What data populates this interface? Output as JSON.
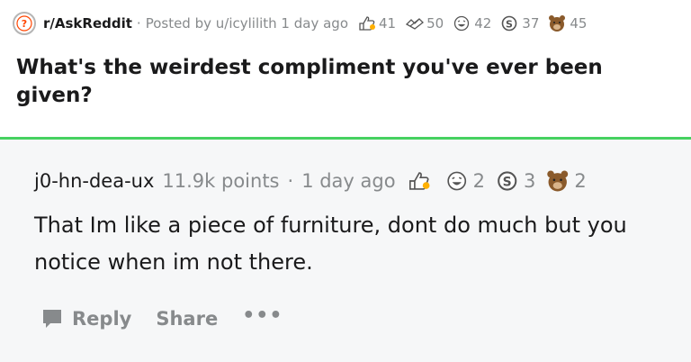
{
  "post": {
    "subreddit": "r/AskReddit",
    "separator": "·",
    "posted_by": "Posted by u/icylilith 1 day ago",
    "awards": [
      {
        "icon": "helpful-award-icon",
        "count": "41"
      },
      {
        "icon": "wholesome-award-icon",
        "count": "50"
      },
      {
        "icon": "laughing-award-icon",
        "count": "42"
      },
      {
        "icon": "silver-award-icon",
        "count": "37"
      },
      {
        "icon": "bear-award-icon",
        "count": "45"
      }
    ],
    "title": "What's the weirdest compliment you've ever been given?"
  },
  "comment": {
    "author": "j0-hn-dea-ux",
    "points": "11.9k points",
    "separator": "·",
    "time": "1 day ago",
    "awards": [
      {
        "icon": "helpful-award-icon",
        "count": ""
      },
      {
        "icon": "laughing-award-icon",
        "count": "2"
      },
      {
        "icon": "silver-award-icon",
        "count": "3"
      },
      {
        "icon": "bear-award-icon",
        "count": "2"
      }
    ],
    "body": "That Im like a piece of furniture, dont do much but you notice when im not there.",
    "actions": {
      "reply_label": "Reply",
      "share_label": "Share",
      "more_label": "•••"
    }
  },
  "colors": {
    "divider": "#46d160",
    "comment_bg": "#f6f7f8",
    "muted_text": "#878a8c",
    "text": "#1a1a1b"
  }
}
